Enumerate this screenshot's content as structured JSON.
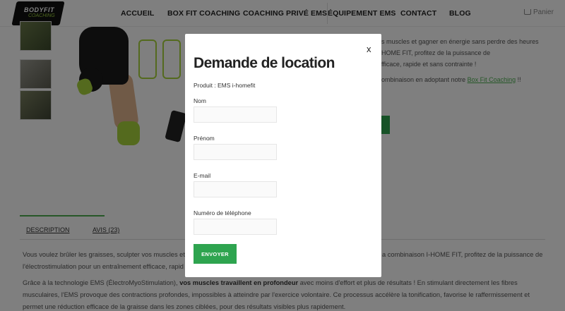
{
  "header": {
    "logo_text": "BODYFIT",
    "logo_sub": "COACHING",
    "nav": [
      "ACCUEIL",
      "BOX FIT COACHING",
      "COACHING PRIVÉ EMS",
      "ÉQUIPEMENT EMS",
      "CONTACT",
      "BLOG"
    ],
    "cart_label": "Panier"
  },
  "product_bg": {
    "line1": "s muscles et gagner en énergie sans perdre des heures",
    "line2": "HOME FIT, profitez de la puissance de",
    "line3": "fficace, rapide et sans contrainte !",
    "line4_prefix": "ombinaison en adoptant notre",
    "line4_link": "Box Fit Coaching",
    "line4_suffix": "!!"
  },
  "tabs": {
    "description": "DESCRIPTION",
    "avis": "AVIS (23)"
  },
  "description": {
    "p1_left": "Vous voulez brûler les graisses, sculpter vos muscles et g",
    "p1_right": "a combinaison I-HOME FIT, profitez de la puissance de",
    "p1_line2": "l'électrostimulation pour un entraînement efficace, rapid",
    "p2_start": "Grâce à la technologie EMS (ÉlectroMyoStimulation),",
    "p2_bold": "vos muscles travaillent en profondeur",
    "p2_end": "avec moins d'effort et plus de résultats ! En stimulant directement les fibres",
    "p2_line2": "musculaires, l'EMS provoque des contractions profondes, impossibles à atteindre par l'exercice volontaire. Ce processus accélère la tonification, favorise le raffermissement et",
    "p2_line3": "permet une réduction efficace de la graisse dans les zones ciblées, pour des résultats visibles plus rapidement."
  },
  "modal": {
    "close": "x",
    "title": "Demande de location",
    "product": "Produit : EMS i-homefit",
    "fields": [
      {
        "label": "Nom",
        "value": ""
      },
      {
        "label": "Prénom",
        "value": ""
      },
      {
        "label": "E-mail",
        "value": ""
      },
      {
        "label": "Numéro de téléphone",
        "value": ""
      }
    ],
    "submit": "ENVOYER"
  },
  "colors": {
    "accent": "#2ea44f",
    "overlay": "rgba(0,0,0,0.5)"
  }
}
